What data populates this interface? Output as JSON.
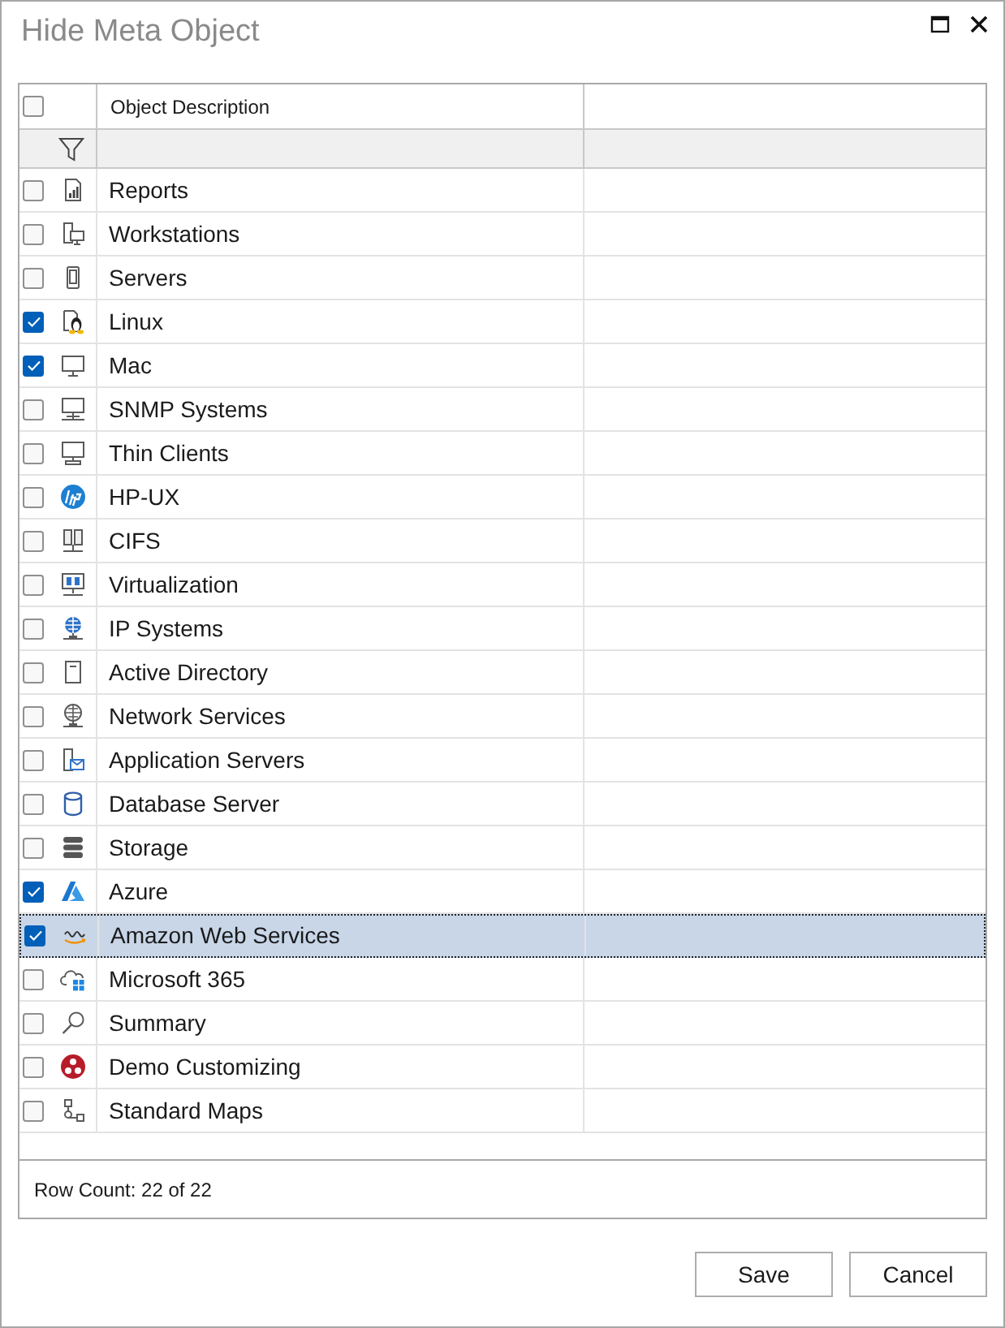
{
  "window": {
    "title": "Hide Meta Object"
  },
  "grid": {
    "select_all": {
      "checked": false
    },
    "columns": [
      {
        "label": "Object Description"
      }
    ],
    "rows": [
      {
        "name": "Reports",
        "checked": false,
        "selected": false
      },
      {
        "name": "Workstations",
        "checked": false,
        "selected": false
      },
      {
        "name": "Servers",
        "checked": false,
        "selected": false
      },
      {
        "name": "Linux",
        "checked": true,
        "selected": false
      },
      {
        "name": "Mac",
        "checked": true,
        "selected": false
      },
      {
        "name": "SNMP Systems",
        "checked": false,
        "selected": false
      },
      {
        "name": "Thin Clients",
        "checked": false,
        "selected": false
      },
      {
        "name": "HP-UX",
        "checked": false,
        "selected": false
      },
      {
        "name": "CIFS",
        "checked": false,
        "selected": false
      },
      {
        "name": "Virtualization",
        "checked": false,
        "selected": false
      },
      {
        "name": "IP Systems",
        "checked": false,
        "selected": false
      },
      {
        "name": "Active Directory",
        "checked": false,
        "selected": false
      },
      {
        "name": "Network Services",
        "checked": false,
        "selected": false
      },
      {
        "name": "Application Servers",
        "checked": false,
        "selected": false
      },
      {
        "name": "Database Server",
        "checked": false,
        "selected": false
      },
      {
        "name": "Storage",
        "checked": false,
        "selected": false
      },
      {
        "name": "Azure",
        "checked": true,
        "selected": false
      },
      {
        "name": "Amazon Web Services",
        "checked": true,
        "selected": true
      },
      {
        "name": "Microsoft 365",
        "checked": false,
        "selected": false
      },
      {
        "name": "Summary",
        "checked": false,
        "selected": false
      },
      {
        "name": "Demo Customizing",
        "checked": false,
        "selected": false
      },
      {
        "name": "Standard Maps",
        "checked": false,
        "selected": false
      }
    ],
    "footer": "Row Count: 22 of 22"
  },
  "buttons": [
    {
      "label": "Save"
    },
    {
      "label": "Cancel"
    }
  ]
}
